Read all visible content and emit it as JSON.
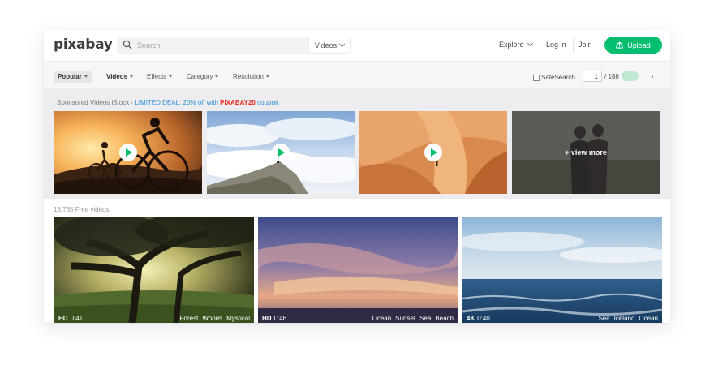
{
  "header": {
    "logo": "pixabay",
    "search_placeholder": "Search",
    "search_type": "Videos",
    "explore": "Explore",
    "login": "Log in",
    "join": "Join",
    "upload": "Upload"
  },
  "filters": {
    "popular": "Popular",
    "videos": "Videos",
    "effects": "Effects",
    "category": "Category",
    "resolution": "Resolution",
    "safesearch": "SafeSearch",
    "page": "1",
    "total_pages": "/ 188",
    "prev": "‹",
    "next": "›"
  },
  "sponsored": {
    "prefix": "Sponsored Videos iStock - ",
    "deal": "LIMITED DEAL: 20% off with ",
    "code": "PIXABAY20",
    "suffix": " coupon",
    "view_more": "+ view more"
  },
  "free_count": "18,765 Free videos",
  "videos": [
    {
      "res": "HD",
      "duration": "0:41",
      "tags": [
        "Forest",
        "Woods",
        "Mystical"
      ]
    },
    {
      "res": "HD",
      "duration": "0:46",
      "tags": [
        "Ocean",
        "Sunset",
        "Sea",
        "Beach"
      ]
    },
    {
      "res": "4K",
      "duration": "0:40",
      "tags": [
        "Sea",
        "Iceland",
        "Ocean"
      ]
    }
  ],
  "colors": {
    "brand_green": "#02be6e",
    "deal_blue": "#2a8fd6",
    "coupon_red": "#e8261d"
  }
}
